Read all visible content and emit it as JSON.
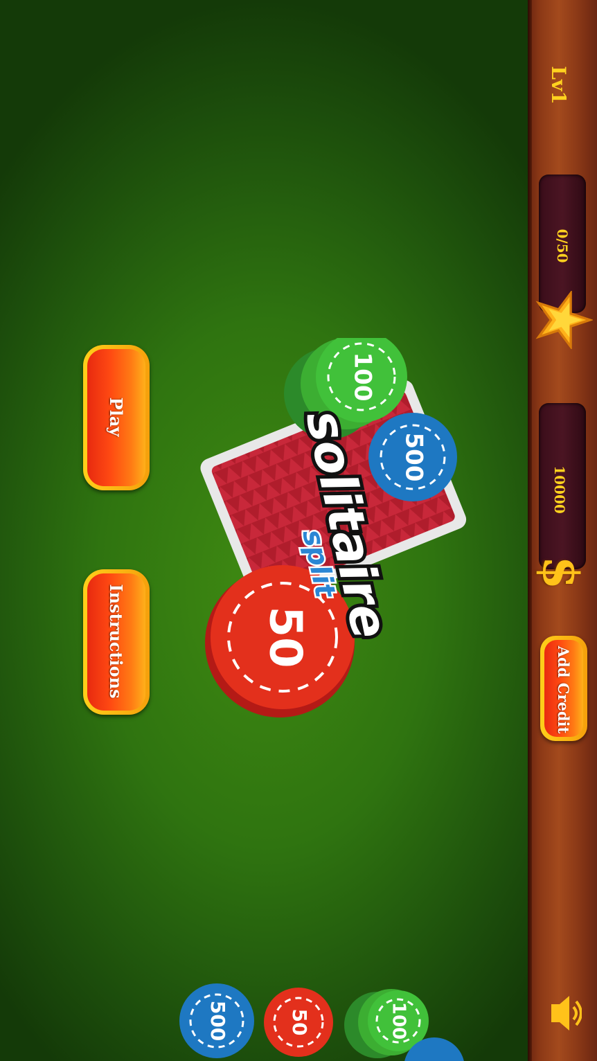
{
  "level_label": "Lv1",
  "stars": {
    "value": "0/50"
  },
  "credits": {
    "value": "10000"
  },
  "add_credit_label": "Add Credit",
  "menu": {
    "play_label": "Play",
    "instructions_label": "Instructions"
  },
  "logo": {
    "word1": "solitaire",
    "word2": "split"
  },
  "chips": {
    "green": "100",
    "blue": "500",
    "red": "50"
  },
  "colors": {
    "felt": "#3f8a12",
    "wood": "#a34a1d",
    "gold": "#ffd21f",
    "button": "#ff4a12",
    "card": "#b8202e"
  }
}
